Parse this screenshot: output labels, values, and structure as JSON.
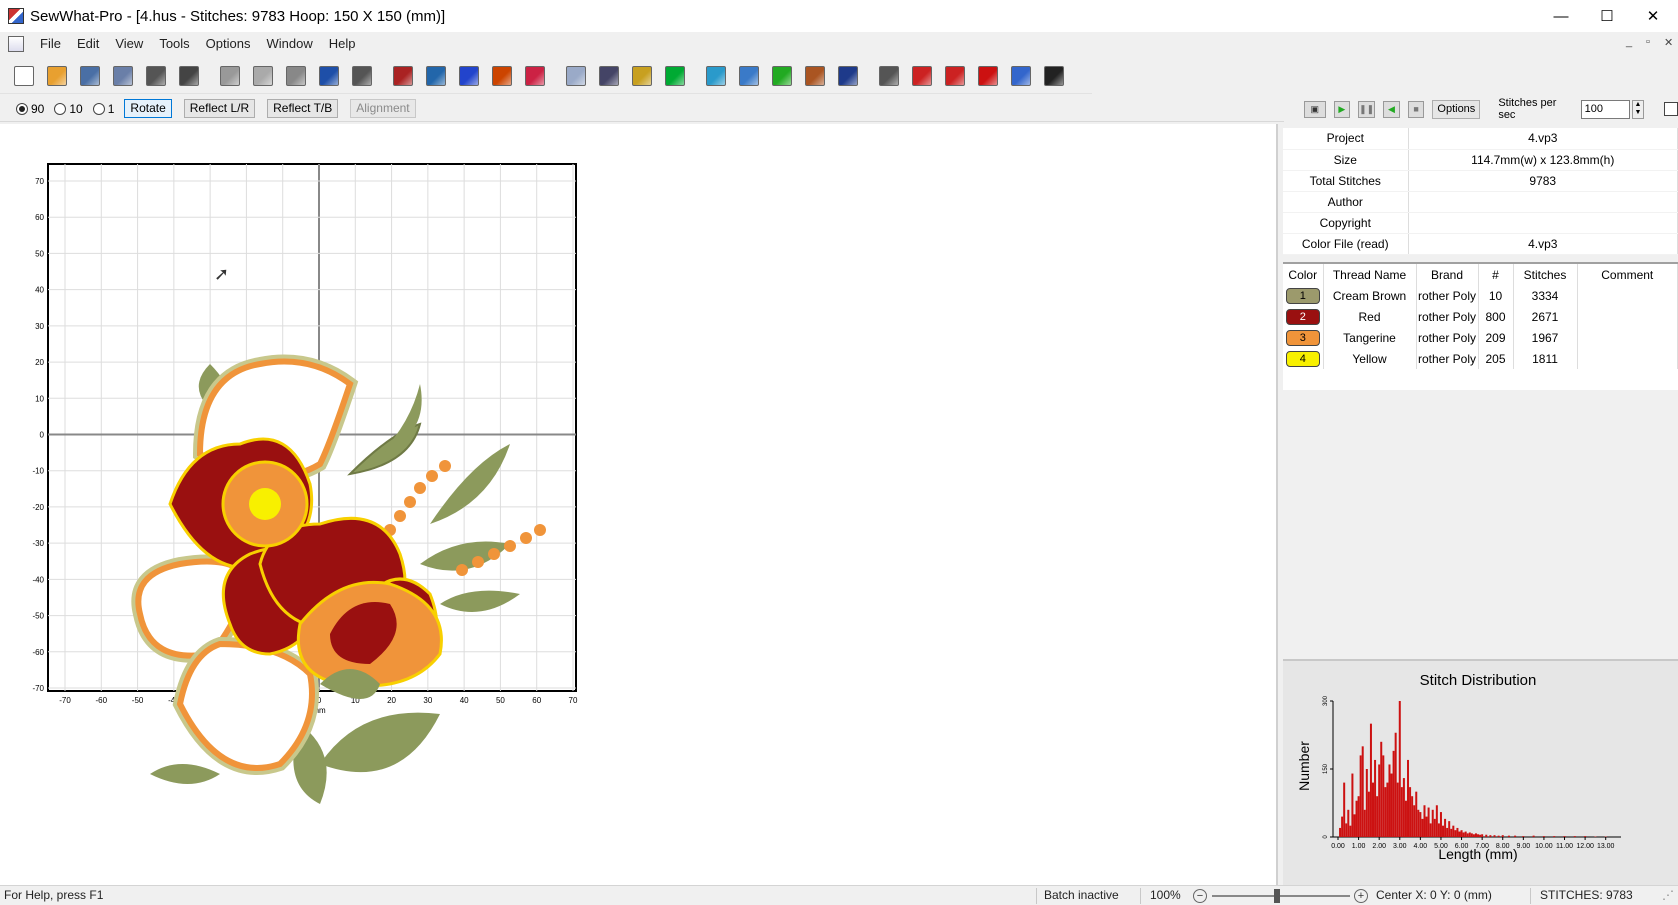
{
  "window": {
    "title": "SewWhat-Pro - [4.hus - Stitches: 9783  Hoop:  150 X  150 (mm)]",
    "controls": {
      "minimize": "—",
      "maximize": "☐",
      "close": "✕"
    }
  },
  "menu": {
    "items": [
      "File",
      "Edit",
      "View",
      "Tools",
      "Options",
      "Window",
      "Help"
    ]
  },
  "toolbar": {
    "icons": [
      "new-file-icon",
      "open-folder-icon",
      "save-icon",
      "save-as-icon",
      "print-icon",
      "print-preview-icon",
      "cut-icon",
      "copy-icon",
      "paste-icon",
      "undo-icon",
      "redo-icon",
      "split-icon",
      "convert-icon",
      "bold-b-icon",
      "text-a-icon",
      "spell-icon",
      "layers-icon",
      "design-info-icon",
      "hoop-icon",
      "stop-color-icon",
      "shirt-icon",
      "background-icon",
      "color-gradient-icon",
      "tools-icon",
      "needle-icon",
      "group-icon",
      "merge-icon",
      "split-colors-icon",
      "grid-icon",
      "help-icon",
      "whats-this-icon"
    ],
    "colors": [
      "#ffffff",
      "#e8a030",
      "#4a6fa5",
      "#6a7fa8",
      "#555555",
      "#444444",
      "#999999",
      "#aaaaaa",
      "#888888",
      "#1e4fa8",
      "#555555",
      "#aa2222",
      "#2266aa",
      "#2244cc",
      "#cc4400",
      "#cc2244",
      "#9aaac8",
      "#444466",
      "#c8a020",
      "#00aa33",
      "#2a9acb",
      "#3a7ac8",
      "#22aa22",
      "#aa5522",
      "#1e3a8a",
      "#555555",
      "#cc2222",
      "#cc2222",
      "#cc1111",
      "#3366cc",
      "#222222"
    ]
  },
  "rotation": {
    "options": [
      {
        "label": "90",
        "checked": true
      },
      {
        "label": "10",
        "checked": false
      },
      {
        "label": "1",
        "checked": false
      }
    ],
    "buttons": {
      "rotate": "Rotate",
      "reflect_lr": "Reflect L/R",
      "reflect_tb": "Reflect T/B",
      "alignment": "Alignment"
    }
  },
  "playback": {
    "options_label": "Options",
    "sps_label": "Stitches per sec",
    "sps_value": "100"
  },
  "design": {
    "unit": "mm",
    "x_ticks": [
      "-70",
      "-60",
      "-50",
      "-40",
      "-30",
      "-20",
      "-10",
      "0",
      "10",
      "20",
      "30",
      "40",
      "50",
      "60",
      "70"
    ],
    "y_ticks": [
      "70",
      "60",
      "50",
      "40",
      "30",
      "20",
      "10",
      "0",
      "-10",
      "-20",
      "-30",
      "-40",
      "-50",
      "-60",
      "-70"
    ]
  },
  "info": {
    "rows": [
      {
        "label": "Project",
        "value": "4.vp3"
      },
      {
        "label": "Size",
        "value": "114.7mm(w) x 123.8mm(h)"
      },
      {
        "label": "Total Stitches",
        "value": "9783"
      },
      {
        "label": "Author",
        "value": ""
      },
      {
        "label": "Copyright",
        "value": ""
      },
      {
        "label": "Color File (read)",
        "value": "4.vp3"
      }
    ]
  },
  "threads": {
    "headers": [
      "Color",
      "Thread Name",
      "Brand",
      "#",
      "Stitches",
      "Comment"
    ],
    "rows": [
      {
        "index": "1",
        "color": "#9c9a6c",
        "name": "Cream Brown",
        "brand": "rother Poly",
        "code": "10",
        "stitches": "3334",
        "comment": ""
      },
      {
        "index": "2",
        "color": "#9a1010",
        "name": "Red",
        "brand": "rother Poly",
        "code": "800",
        "stitches": "2671",
        "comment": ""
      },
      {
        "index": "3",
        "color": "#f0943a",
        "name": "Tangerine",
        "brand": "rother Poly",
        "code": "209",
        "stitches": "1967",
        "comment": ""
      },
      {
        "index": "4",
        "color": "#f8f000",
        "name": "Yellow",
        "brand": "rother Poly",
        "code": "205",
        "stitches": "1811",
        "comment": ""
      }
    ]
  },
  "stitch_distribution": {
    "title": "Stitch Distribution",
    "xlabel": "Length (mm)",
    "ylabel": "Number",
    "y_tick_labels": [
      "0",
      "150",
      "300"
    ]
  },
  "chart_data": {
    "type": "bar",
    "title": "Stitch Distribution",
    "xlabel": "Length (mm)",
    "ylabel": "Number",
    "categories": [
      "0.00",
      "1.00",
      "2.00",
      "3.00",
      "4.00",
      "5.00",
      "6.00",
      "7.00",
      "8.00",
      "9.00",
      "10.00",
      "11.00",
      "12.00",
      "13.00"
    ],
    "xlim": [
      0,
      13.5
    ],
    "ylim": [
      0,
      300
    ],
    "bars_x": [
      0.1,
      0.2,
      0.3,
      0.4,
      0.5,
      0.6,
      0.7,
      0.8,
      0.9,
      1.0,
      1.1,
      1.2,
      1.3,
      1.4,
      1.5,
      1.6,
      1.7,
      1.8,
      1.9,
      2.0,
      2.1,
      2.2,
      2.3,
      2.4,
      2.5,
      2.6,
      2.7,
      2.8,
      2.9,
      3.0,
      3.1,
      3.2,
      3.3,
      3.4,
      3.5,
      3.6,
      3.7,
      3.8,
      3.9,
      4.0,
      4.1,
      4.2,
      4.3,
      4.4,
      4.5,
      4.6,
      4.7,
      4.8,
      4.9,
      5.0,
      5.1,
      5.2,
      5.3,
      5.4,
      5.5,
      5.6,
      5.7,
      5.8,
      5.9,
      6.0,
      6.1,
      6.2,
      6.3,
      6.4,
      6.5,
      6.6,
      6.7,
      6.8,
      6.9,
      7.0,
      7.2,
      7.4,
      7.6,
      7.8,
      8.0,
      8.3,
      8.6,
      9.0,
      9.5,
      10.0,
      10.5,
      11.0,
      11.5,
      12.0,
      12.5,
      13.0
    ],
    "values": [
      20,
      45,
      120,
      30,
      60,
      25,
      140,
      50,
      80,
      90,
      180,
      200,
      60,
      150,
      100,
      250,
      120,
      170,
      90,
      160,
      210,
      180,
      110,
      120,
      160,
      140,
      190,
      230,
      120,
      300,
      110,
      130,
      80,
      170,
      110,
      90,
      70,
      100,
      60,
      55,
      40,
      70,
      45,
      65,
      30,
      60,
      40,
      70,
      30,
      55,
      25,
      40,
      20,
      35,
      18,
      25,
      15,
      20,
      12,
      15,
      10,
      12,
      8,
      10,
      8,
      6,
      8,
      6,
      5,
      6,
      5,
      4,
      4,
      3,
      4,
      3,
      3,
      2,
      3,
      2,
      2,
      2,
      2,
      2,
      1,
      1
    ]
  },
  "status": {
    "help": "For Help, press F1",
    "batch": "Batch inactive",
    "zoom": "100%",
    "center": "Center X:  0  Y:  0 (mm)",
    "stitches": "STITCHES:  9783"
  }
}
